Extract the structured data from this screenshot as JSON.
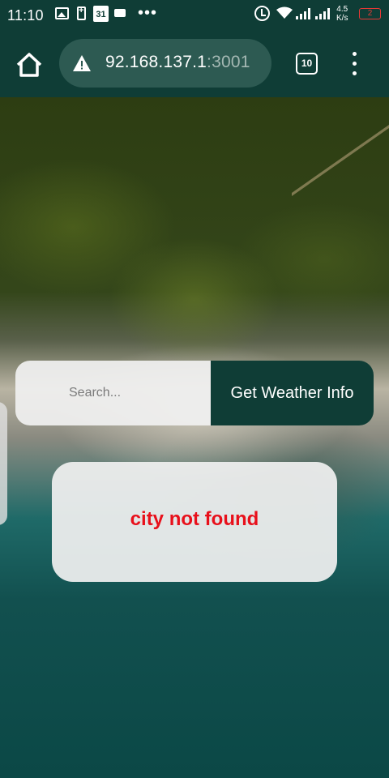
{
  "status_bar": {
    "time": "11:10",
    "calendar_day": "31",
    "more_dots": "•••",
    "speed": "4.5\nK/s",
    "speed_value": "4.5",
    "speed_unit": "K/s",
    "battery": "2",
    "icons": [
      "image-icon",
      "battery-saver-icon",
      "calendar-icon",
      "message-icon",
      "alarm-icon",
      "wifi-icon",
      "signal-icon",
      "signal-icon",
      "battery-icon"
    ]
  },
  "browser": {
    "url_host": "92.168.137.1",
    "url_port": ":3001",
    "tab_count": "10",
    "icons": [
      "home-icon",
      "warning-icon",
      "tabs-icon",
      "more-vert-icon"
    ]
  },
  "weather": {
    "search_placeholder": "Search...",
    "button_label": "Get Weather Info",
    "error_message": "city not found"
  },
  "colors": {
    "accent": "#0f3d36",
    "error": "#e8101b",
    "battery_low": "#e53935"
  }
}
